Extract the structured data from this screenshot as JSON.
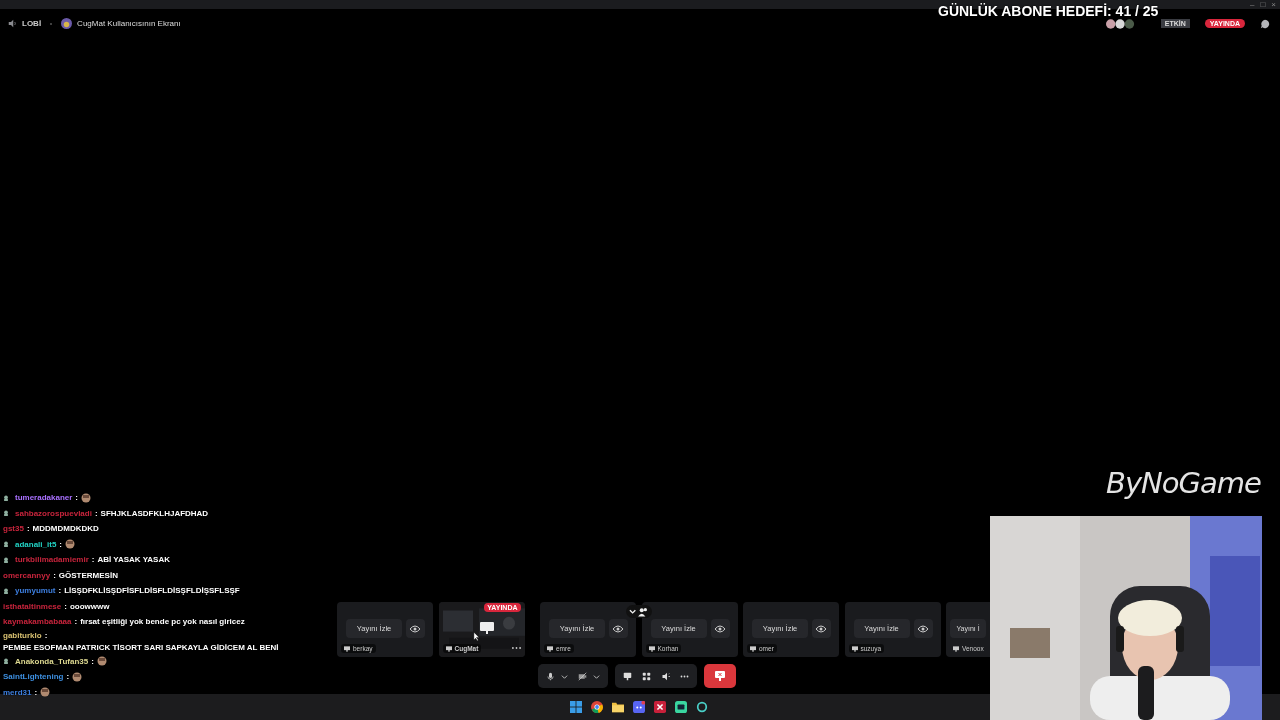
{
  "titlebar": {
    "window_controls": [
      "–",
      "□",
      "×"
    ]
  },
  "header": {
    "channel": "LOBİ",
    "stream_title": "CugMat Kullanıcısının Ekranı",
    "status_badge": "ETKİN",
    "live_badge": "YAYINDA"
  },
  "overlay": {
    "goal": "GÜNLÜK ABONE HEDEFİ: 41 / 25",
    "logo": "ByNoGame"
  },
  "chat": [
    {
      "user": "tumeradakaner",
      "sep": ":",
      "color": "#a970ff",
      "badge": true,
      "kind": "emote"
    },
    {
      "user": "sahbazorospuevladi",
      "sep": ":",
      "color": "#c8243c",
      "badge": true,
      "kind": "text",
      "text": "SFHJKLASDFKLHJAFDHAD"
    },
    {
      "user": "gst35",
      "sep": ":",
      "color": "#c8243c",
      "badge": false,
      "kind": "text",
      "text": "MDDMDMDKDKD"
    },
    {
      "user": "adanali_it5",
      "sep": ":",
      "color": "#22d3c5",
      "badge": true,
      "kind": "emote"
    },
    {
      "user": "turkbilimadamiemir",
      "sep": ":",
      "color": "#c8243c",
      "badge": true,
      "kind": "text",
      "text": "ABİ YASAK YASAK"
    },
    {
      "user": "omercannyy",
      "sep": ":",
      "color": "#c8243c",
      "badge": false,
      "kind": "text",
      "text": "GÖSTERMESİN"
    },
    {
      "user": "yumyumut",
      "sep": ":",
      "color": "#3d7fe0",
      "badge": true,
      "kind": "text",
      "text": "LİSŞDFKLİSŞDFİSFLDİSFLDİSŞFLDİŞSFLSŞF"
    },
    {
      "user": "isthataltinmese",
      "sep": ":",
      "color": "#c8243c",
      "badge": false,
      "kind": "text",
      "text": "ooowwww"
    },
    {
      "user": "kaymakambabaaa",
      "sep": ":",
      "color": "#c8243c",
      "badge": false,
      "kind": "text",
      "text": "fırsat eşitliği yok bende pc yok nasıl giricez"
    },
    {
      "user": "gabiturklo",
      "sep": ":",
      "color": "#d8c070",
      "badge": false,
      "kind": "text",
      "text": "PEMBE ESOFMAN PATRICK TİSORT SARI SAPKAYLA GİDİCEM AL BENİ"
    },
    {
      "user": "Anakonda_Tufan35",
      "sep": ":",
      "color": "#ddd890",
      "badge": true,
      "kind": "emote"
    },
    {
      "user": "SaintLightening",
      "sep": ":",
      "color": "#3d8fe0",
      "badge": false,
      "kind": "emote"
    },
    {
      "user": "merd31",
      "sep": ":",
      "color": "#3d7fe0",
      "badge": false,
      "kind": "emote"
    }
  ],
  "streams": [
    {
      "name": "berkay",
      "kind": "idle",
      "button": "Yayını İzle"
    },
    {
      "name": "CugMat",
      "kind": "live",
      "badge": "YAYINDA"
    },
    {
      "name": "emre",
      "kind": "idle",
      "button": "Yayını İzle"
    },
    {
      "name": "Korhan",
      "kind": "idle",
      "button": "Yayını İzle"
    },
    {
      "name": "omer",
      "kind": "idle",
      "button": "Yayını İzle"
    },
    {
      "name": "suzuya",
      "kind": "idle",
      "button": "Yayını İzle"
    },
    {
      "name": "Venoox",
      "kind": "partial",
      "button": "Yayını İ"
    }
  ]
}
